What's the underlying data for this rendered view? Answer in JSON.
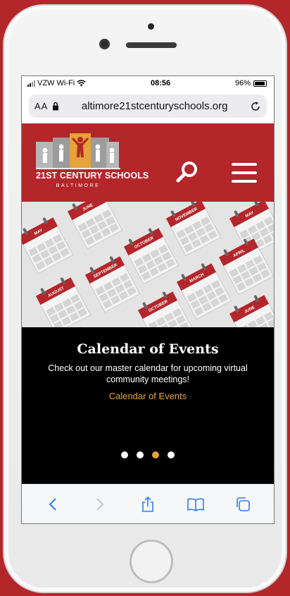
{
  "status_bar": {
    "carrier": "VZW Wi-Fi",
    "time": "08:56",
    "battery": "96%",
    "battery_level": 0.96
  },
  "address_bar": {
    "text_size_label": "AA",
    "url": "altimore21stcenturyschools.org"
  },
  "header": {
    "logo_title": "21ST CENTURY SCHOOLS",
    "logo_subtitle": "BALTIMORE",
    "icons": [
      "search-icon",
      "hamburger-menu-icon"
    ]
  },
  "hero": {
    "calendar_months": [
      "MAY",
      "JUNE",
      "OCTOBER",
      "NOVEMBER",
      "MAY",
      "AUGUST",
      "SEPTEMBER",
      "OCTOBER",
      "MARCH",
      "APRIL",
      "JUNE"
    ]
  },
  "slide": {
    "title": "Calendar of Events",
    "description": "Check out our master calendar for upcoming virtual community meetings!",
    "link_label": "Calendar of Events",
    "dot_count": 4,
    "active_dot": 3
  },
  "toolbar": {
    "icons": [
      "back-icon",
      "forward-icon",
      "share-icon",
      "bookmarks-icon",
      "tabs-icon"
    ]
  },
  "colors": {
    "brand_red": "#b3262a",
    "accent_gold": "#e8a23a",
    "black": "#000000"
  }
}
